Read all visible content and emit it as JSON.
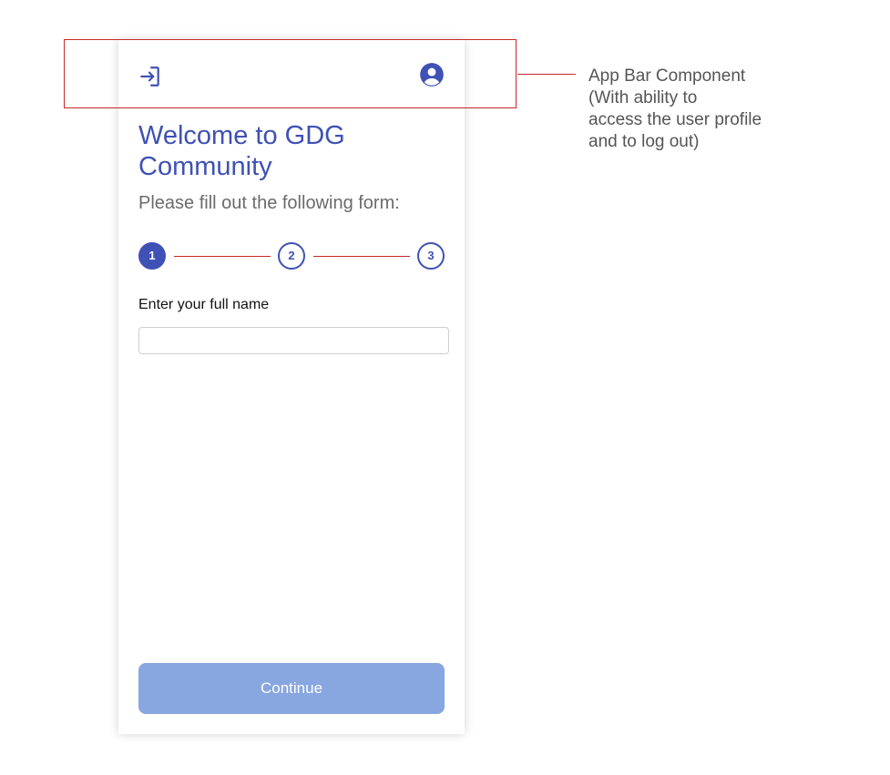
{
  "app_bar": {
    "login_icon": "login-icon",
    "profile_icon": "account-circle-icon"
  },
  "header": {
    "title": "Welcome to GDG Community",
    "subtitle": "Please fill out the following form:"
  },
  "stepper": {
    "steps": [
      {
        "label": "1",
        "state": "active"
      },
      {
        "label": "2",
        "state": "inactive"
      },
      {
        "label": "3",
        "state": "inactive"
      }
    ]
  },
  "form": {
    "name_label": "Enter your full name",
    "name_value": "",
    "name_placeholder": ""
  },
  "actions": {
    "continue_label": "Continue"
  },
  "annotation": {
    "text": "App Bar Component\n(With ability to\naccess the user profile\nand to log out)"
  },
  "colors": {
    "primary": "#3f51b5",
    "button_disabled": "#88a6e0",
    "annotation_red": "#c62828"
  }
}
